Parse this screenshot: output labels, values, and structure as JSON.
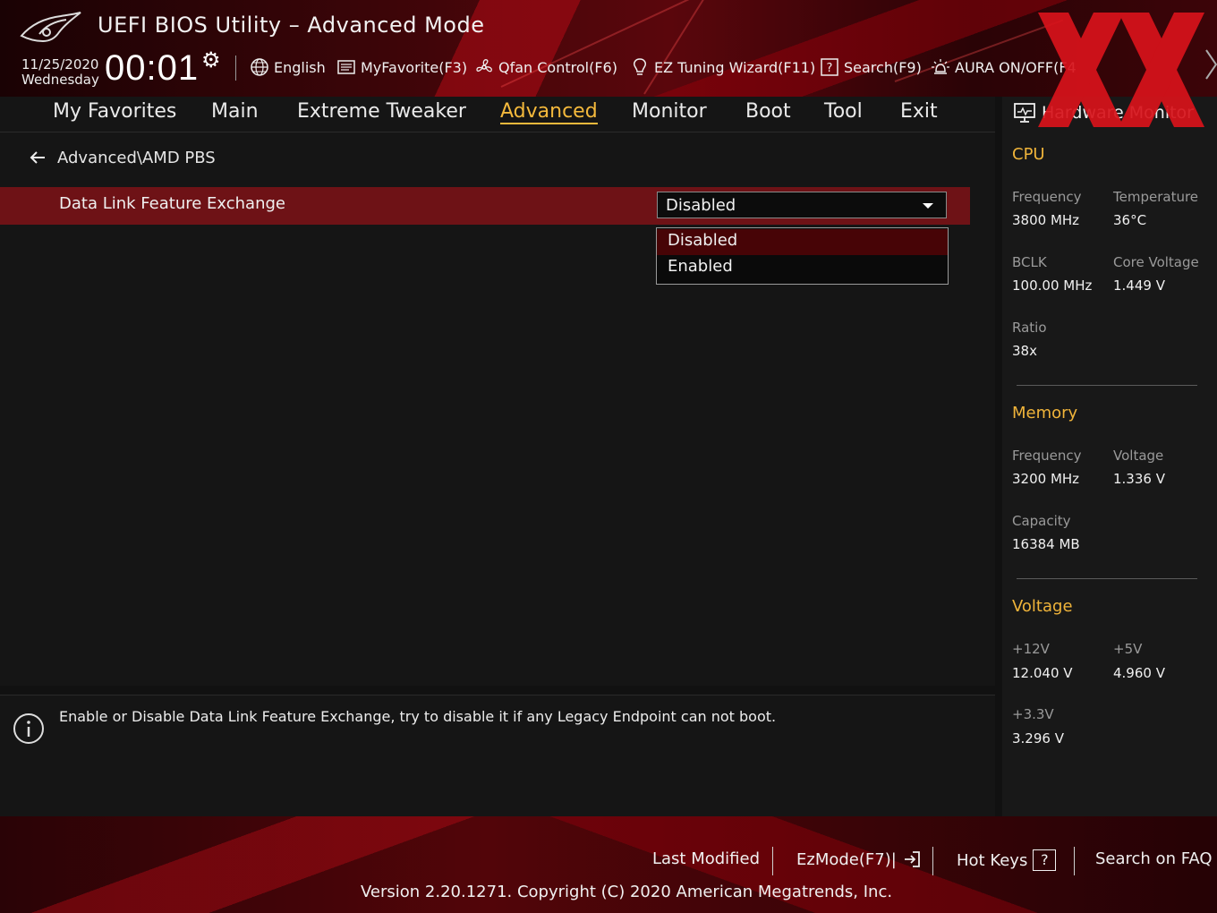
{
  "header": {
    "title": "UEFI BIOS Utility – Advanced Mode",
    "date": "11/25/2020",
    "weekday": "Wednesday",
    "time": "00:01",
    "toolbar": [
      {
        "name": "language",
        "label": "English",
        "icon": "globe-icon"
      },
      {
        "name": "myfavorite",
        "label": "MyFavorite(F3)",
        "icon": "list-icon"
      },
      {
        "name": "qfan",
        "label": "Qfan Control(F6)",
        "icon": "fan-icon"
      },
      {
        "name": "ez-tuning",
        "label": "EZ Tuning Wizard(F11)",
        "icon": "bulb-icon"
      },
      {
        "name": "search",
        "label": "Search(F9)",
        "icon": "question-box-icon"
      },
      {
        "name": "aura",
        "label": "AURA ON/OFF(F4",
        "icon": "aura-icon"
      }
    ]
  },
  "nav": {
    "tabs": [
      "My Favorites",
      "Main",
      "Extreme Tweaker",
      "Advanced",
      "Monitor",
      "Boot",
      "Tool",
      "Exit"
    ],
    "active": "Advanced"
  },
  "main": {
    "breadcrumb": "Advanced\\AMD PBS",
    "setting": {
      "label": "Data Link Feature Exchange",
      "value": "Disabled",
      "options": [
        "Disabled",
        "Enabled"
      ],
      "highlighted_option": "Disabled"
    }
  },
  "help": {
    "text": "Enable or Disable Data Link Feature Exchange, try to disable it if any Legacy Endpoint can not boot."
  },
  "hwmon": {
    "title": "Hardware Monitor",
    "cpu": {
      "heading": "CPU",
      "frequency_label": "Frequency",
      "frequency": "3800 MHz",
      "temperature_label": "Temperature",
      "temperature": "36°C",
      "bclk_label": "BCLK",
      "bclk": "100.00 MHz",
      "core_voltage_label": "Core Voltage",
      "core_voltage": "1.449 V",
      "ratio_label": "Ratio",
      "ratio": "38x"
    },
    "memory": {
      "heading": "Memory",
      "frequency_label": "Frequency",
      "frequency": "3200 MHz",
      "voltage_label": "Voltage",
      "voltage": "1.336 V",
      "capacity_label": "Capacity",
      "capacity": "16384 MB"
    },
    "voltage": {
      "heading": "Voltage",
      "v12_label": "+12V",
      "v12": "12.040 V",
      "v5_label": "+5V",
      "v5": "4.960 V",
      "v33_label": "+3.3V",
      "v33": "3.296 V"
    }
  },
  "footer": {
    "last_modified": "Last Modified",
    "ezmode": "EzMode(F7)|",
    "hotkeys": "Hot Keys",
    "hotkeys_key": "?",
    "faq": "Search on FAQ",
    "version": "Version 2.20.1271. Copyright (C) 2020 American Megatrends, Inc."
  },
  "colors": {
    "accent": "#f4b93c",
    "selected_row": "#6e1216",
    "selected_option": "#470406",
    "panel": "#151515"
  }
}
